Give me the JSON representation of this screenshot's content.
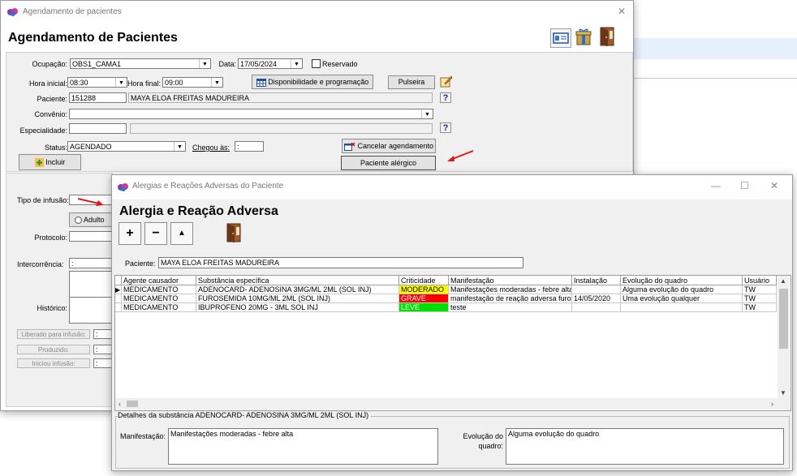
{
  "main_window": {
    "title": "Agendamento de pacientes",
    "heading": "Agendamento de Pacientes",
    "close_glyph": "✕",
    "form": {
      "ocupacao_label": "Ocupação:",
      "ocupacao_value": "OBS1_CAMA1",
      "data_label": "Data:",
      "data_value": "17/05/2024",
      "reservado_label": "Reservado",
      "hora_inicial_label": "Hora inicial:",
      "hora_inicial_value": "08:30",
      "hora_final_label": "Hora final:",
      "hora_final_value": "09:00",
      "disponibilidade_button": "Disponibilidade e programação",
      "pulseira_button": "Pulseira",
      "paciente_label": "Paciente:",
      "paciente_code": "151288",
      "paciente_name": "MAYA ELOA FREITAS MADUREIRA",
      "convenio_label": "Convênio:",
      "convenio_value": "",
      "especialidade_label": "Especialidade:",
      "status_label": "Status:",
      "status_value": "AGENDADO",
      "chegou_label": "Chegou às:",
      "chegou_value": ":",
      "cancelar_button": "Cancelar agendamento",
      "incluir_button": "Incluir",
      "paciente_alergico_button": "Paciente alérgico",
      "help_glyph": "?"
    },
    "lower": {
      "tipo_infusao_label": "Tipo de infusão:",
      "adulto_label": "Adulto",
      "protocolo_label": "Protocolo:",
      "intercorrencia_label": "Intercorrência:",
      "intercorrencia_value": ":",
      "historico_label": "Histórico:",
      "liberado_label": "Liberado para infusão:",
      "liberado_value": ":",
      "produzido_label": "Produzido:",
      "produzido_value": ":",
      "iniciou_label": "Iniciou infusão:",
      "iniciou_value": ":"
    }
  },
  "dialog": {
    "title": "Alergias e Reações Adversas do Paciente",
    "heading": "Alergia e Reação Adversa",
    "window_controls": {
      "minimize": "—",
      "maximize": "☐",
      "close": "✕"
    },
    "toolbar": {
      "add": "+",
      "remove": "−",
      "up": "▲"
    },
    "paciente_label": "Paciente:",
    "paciente_value": "MAYA ELOA FREITAS MADUREIRA",
    "columns": [
      "Agente causador",
      "Substância específica",
      "Criticidade",
      "Manifestação",
      "Instalação",
      "Evolução do quadro",
      "Usuário"
    ],
    "rows": [
      {
        "agente": "MEDICAMENTO",
        "substancia": "ADENOCARD- ADENOSINA 3MG/ML 2ML (SOL INJ)",
        "criticidade": "MODERADO",
        "crit_color": "#ffff00",
        "crit_text_color": "#000000",
        "manifestacao": "Manifestações moderadas - febre alta",
        "instalacao": "",
        "evolucao": "Alguma evolução do quadro",
        "usuario": "TW"
      },
      {
        "agente": "MEDICAMENTO",
        "substancia": "FUROSEMIDA 10MG/ML 2ML (SOL INJ)",
        "criticidade": "GRAVE",
        "crit_color": "#ff0000",
        "crit_text_color": "#ffffff",
        "manifestacao": "manifestação de reação adversa furos",
        "instalacao": "14/05/2020",
        "evolucao": "Uma evolução qualquer",
        "usuario": "TW"
      },
      {
        "agente": "MEDICAMENTO",
        "substancia": "IBUPROFENO 20MG - 3ML SOL INJ",
        "criticidade": "LEVE",
        "crit_color": "#00e000",
        "crit_text_color": "#ffffff",
        "manifestacao": "teste",
        "instalacao": "",
        "evolucao": "",
        "usuario": "TW"
      }
    ],
    "details_group_title": "Detalhes da substância ADENOCARD- ADENOSINA 3MG/ML 2ML (SOL INJ)",
    "manifestacao_label": "Manifestação:",
    "manifestacao_value": "Manifestações moderadas - febre alta",
    "evolucao_label_1": "Evolução do",
    "evolucao_label_2": "quadro:",
    "evolucao_value": "Alguma evolução do quadro"
  }
}
